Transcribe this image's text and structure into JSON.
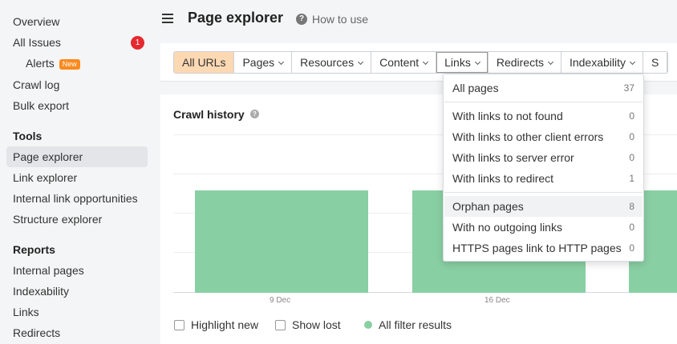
{
  "sidebar": {
    "items": [
      {
        "label": "Overview"
      },
      {
        "label": "All Issues",
        "badge": "1"
      },
      {
        "label": "Alerts",
        "badge_new": "New"
      },
      {
        "label": "Crawl log"
      },
      {
        "label": "Bulk export"
      }
    ],
    "tools_heading": "Tools",
    "tools": [
      "Page explorer",
      "Link explorer",
      "Internal link opportunities",
      "Structure explorer"
    ],
    "reports_heading": "Reports",
    "reports": [
      "Internal pages",
      "Indexability",
      "Links",
      "Redirects"
    ]
  },
  "header": {
    "title": "Page explorer",
    "help_label": "How to use"
  },
  "filters": {
    "tabs": [
      "All URLs",
      "Pages",
      "Resources",
      "Content",
      "Links",
      "Redirects",
      "Indexability",
      "S"
    ]
  },
  "crawl_history": {
    "title": "Crawl history",
    "x_ticks": [
      "9 Dec",
      "16 Dec"
    ],
    "legend": {
      "highlight_new": "Highlight new",
      "show_lost": "Show lost",
      "all_filter": "All filter results"
    },
    "bar_color": "#89cfa4"
  },
  "links_dropdown": {
    "items": [
      {
        "label": "All pages",
        "count": "37"
      },
      {
        "label": "With links to not found",
        "count": "0"
      },
      {
        "label": "With links to other client errors",
        "count": "0"
      },
      {
        "label": "With links to server error",
        "count": "0"
      },
      {
        "label": "With links to redirect",
        "count": "1"
      },
      {
        "label": "Orphan pages",
        "count": "8"
      },
      {
        "label": "With no outgoing links",
        "count": "0"
      },
      {
        "label": "HTTPS pages link to HTTP pages",
        "count": "0"
      }
    ]
  }
}
